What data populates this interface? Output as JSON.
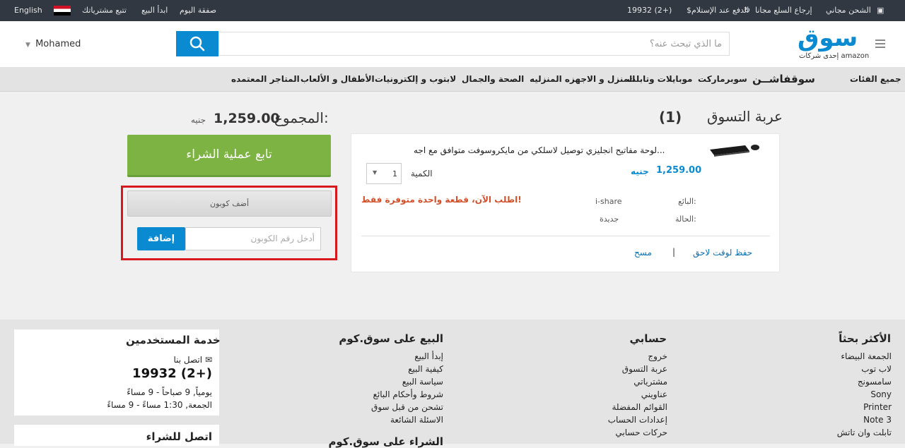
{
  "topbar": {
    "language": "English",
    "track_orders": "تتبع مشترياتك",
    "start_selling": "ابدأ البيع",
    "deal_of_day": "صفقة اليوم",
    "phone": "19932 (2+)",
    "cod": "الدفع عند الإستلام",
    "free_returns": "إرجاع السلع مجانا",
    "free_shipping": "الشحن مجاني"
  },
  "header": {
    "logo_text": "سوق",
    "logo_sub": "إحدى شركات amazon",
    "search_placeholder": "ما الذي تبحث عنه؟",
    "user_name": "Mohamed"
  },
  "nav": {
    "items": [
      "جميع الفئات",
      "سوقفاشــن",
      "سوبرماركت",
      "موبايلات وتابلت",
      "المنزل و الاجهزه المنزليه",
      "الصحة والجمال",
      "لابتوب و إلكترونيات",
      "الأطفال و الألعاب",
      "المتاجر المعتمده"
    ]
  },
  "cart": {
    "title": "عربة التسوق",
    "count": "(1)",
    "total_label": "المجموع:",
    "total_value": "1,259.00",
    "currency": "جنيه",
    "checkout_label": "تابع عملية الشراء",
    "coupon_header": "أضف كوبون",
    "coupon_placeholder": "أدخل رقم الكوبون",
    "coupon_add": "إضافة",
    "item": {
      "name": "لوحة مفاتيح انجليزي توصيل لاسلكي من مايكروسوفت متوافق مع اجه...",
      "price": "1,259.00",
      "currency": "جنيه",
      "qty_label": "الكمية",
      "qty_value": "1",
      "urgency": "اطلب الآن، قطعة واحدة متوفرة فقط!",
      "seller_label": "البائع:",
      "seller_value": "i-share",
      "condition_label": "الحالة:",
      "condition_value": "جديدة",
      "save_later": "حفظ لوقت لاحق",
      "separator": "|",
      "remove": "مسح"
    }
  },
  "footer": {
    "customer_service": {
      "title": "خدمة المستخدمين",
      "contact": "اتصل بنا",
      "phone": "19932 (2+)",
      "hours1": "يومياً, 9 صباحاً - 9 مساءً",
      "hours2": "الجمعة, 1:30 مساءً - 9 مساءً"
    },
    "buy_contact_title": "اتصل للشراء",
    "sell": {
      "title": "البيع على سوق.كوم",
      "links": [
        "إبدأ البيع",
        "كيفية البيع",
        "سياسة البيع",
        "شروط وأحكام البائع",
        "تشحن من قبل سوق",
        "الاسئلة الشائعة"
      ]
    },
    "buy_title": "الشراء على سوق.كوم",
    "account": {
      "title": "حسابي",
      "links": [
        "خروج",
        "عربة التسوق",
        "مشترياتي",
        "عناويني",
        "القوائم المفضلة",
        "إعدادات الحساب",
        "حركات حسابي"
      ]
    },
    "popular": {
      "title": "الأكثر بحثاً",
      "links": [
        "الجمعة البيضاء",
        "لاب توب",
        "سامسونج",
        "Sony",
        "Printer",
        "Note 3",
        "تابلت وان تاتش"
      ]
    }
  }
}
